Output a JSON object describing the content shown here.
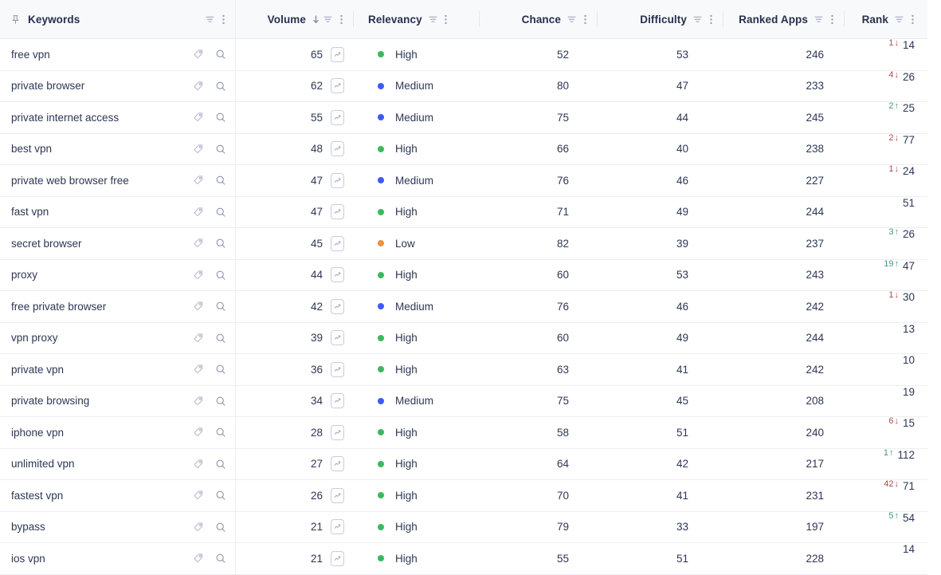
{
  "table": {
    "columns": [
      {
        "key": "keywords",
        "label": "Keywords",
        "align": "left",
        "pin_icon": "pushpin-icon",
        "sorted": false,
        "sort_dir": ""
      },
      {
        "key": "volume",
        "label": "Volume",
        "align": "right",
        "pin_icon": "",
        "sorted": true,
        "sort_dir": "desc"
      },
      {
        "key": "relevancy",
        "label": "Relevancy",
        "align": "left",
        "pin_icon": "",
        "sorted": false,
        "sort_dir": ""
      },
      {
        "key": "chance",
        "label": "Chance",
        "align": "right",
        "pin_icon": "",
        "sorted": false,
        "sort_dir": ""
      },
      {
        "key": "difficulty",
        "label": "Difficulty",
        "align": "right",
        "pin_icon": "",
        "sorted": false,
        "sort_dir": ""
      },
      {
        "key": "ranked_apps",
        "label": "Ranked Apps",
        "align": "right",
        "pin_icon": "",
        "sorted": false,
        "sort_dir": ""
      },
      {
        "key": "rank",
        "label": "Rank",
        "align": "right",
        "pin_icon": "",
        "sorted": false,
        "sort_dir": ""
      }
    ],
    "header_icons": {
      "filter": "filter-icon",
      "menu": "more-options-icon",
      "sort_desc": "sort-descending-arrow-icon"
    },
    "row_icons": {
      "tag": "tag-icon",
      "search": "magnifier-icon",
      "trend_chart": "trend-chart-icon"
    },
    "relevancy_colors": {
      "High": "#3cb95f",
      "Medium": "#3b5bfa",
      "Low": "#eb9240"
    },
    "delta_colors": {
      "up": "#3f9a80",
      "down": "#b5484a"
    },
    "rows": [
      {
        "keyword": "free vpn",
        "volume": "65",
        "relevancy": "High",
        "chance": "52",
        "difficulty": "53",
        "ranked_apps": "246",
        "rank_delta": "1",
        "rank_dir": "down",
        "rank": "14"
      },
      {
        "keyword": "private browser",
        "volume": "62",
        "relevancy": "Medium",
        "chance": "80",
        "difficulty": "47",
        "ranked_apps": "233",
        "rank_delta": "4",
        "rank_dir": "down",
        "rank": "26"
      },
      {
        "keyword": "private internet access",
        "volume": "55",
        "relevancy": "Medium",
        "chance": "75",
        "difficulty": "44",
        "ranked_apps": "245",
        "rank_delta": "2",
        "rank_dir": "up",
        "rank": "25"
      },
      {
        "keyword": "best vpn",
        "volume": "48",
        "relevancy": "High",
        "chance": "66",
        "difficulty": "40",
        "ranked_apps": "238",
        "rank_delta": "2",
        "rank_dir": "down",
        "rank": "77"
      },
      {
        "keyword": "private web browser free",
        "volume": "47",
        "relevancy": "Medium",
        "chance": "76",
        "difficulty": "46",
        "ranked_apps": "227",
        "rank_delta": "1",
        "rank_dir": "down",
        "rank": "24"
      },
      {
        "keyword": "fast vpn",
        "volume": "47",
        "relevancy": "High",
        "chance": "71",
        "difficulty": "49",
        "ranked_apps": "244",
        "rank_delta": "",
        "rank_dir": "",
        "rank": "51"
      },
      {
        "keyword": "secret browser",
        "volume": "45",
        "relevancy": "Low",
        "chance": "82",
        "difficulty": "39",
        "ranked_apps": "237",
        "rank_delta": "3",
        "rank_dir": "up",
        "rank": "26"
      },
      {
        "keyword": "proxy",
        "volume": "44",
        "relevancy": "High",
        "chance": "60",
        "difficulty": "53",
        "ranked_apps": "243",
        "rank_delta": "19",
        "rank_dir": "up",
        "rank": "47"
      },
      {
        "keyword": "free private browser",
        "volume": "42",
        "relevancy": "Medium",
        "chance": "76",
        "difficulty": "46",
        "ranked_apps": "242",
        "rank_delta": "1",
        "rank_dir": "down",
        "rank": "30"
      },
      {
        "keyword": "vpn proxy",
        "volume": "39",
        "relevancy": "High",
        "chance": "60",
        "difficulty": "49",
        "ranked_apps": "244",
        "rank_delta": "",
        "rank_dir": "",
        "rank": "13"
      },
      {
        "keyword": "private vpn",
        "volume": "36",
        "relevancy": "High",
        "chance": "63",
        "difficulty": "41",
        "ranked_apps": "242",
        "rank_delta": "",
        "rank_dir": "",
        "rank": "10"
      },
      {
        "keyword": "private browsing",
        "volume": "34",
        "relevancy": "Medium",
        "chance": "75",
        "difficulty": "45",
        "ranked_apps": "208",
        "rank_delta": "",
        "rank_dir": "",
        "rank": "19"
      },
      {
        "keyword": "iphone vpn",
        "volume": "28",
        "relevancy": "High",
        "chance": "58",
        "difficulty": "51",
        "ranked_apps": "240",
        "rank_delta": "6",
        "rank_dir": "down",
        "rank": "15"
      },
      {
        "keyword": "unlimited vpn",
        "volume": "27",
        "relevancy": "High",
        "chance": "64",
        "difficulty": "42",
        "ranked_apps": "217",
        "rank_delta": "1",
        "rank_dir": "up",
        "rank": "112"
      },
      {
        "keyword": "fastest vpn",
        "volume": "26",
        "relevancy": "High",
        "chance": "70",
        "difficulty": "41",
        "ranked_apps": "231",
        "rank_delta": "42",
        "rank_dir": "down",
        "rank": "71"
      },
      {
        "keyword": "bypass",
        "volume": "21",
        "relevancy": "High",
        "chance": "79",
        "difficulty": "33",
        "ranked_apps": "197",
        "rank_delta": "5",
        "rank_dir": "up",
        "rank": "54"
      },
      {
        "keyword": "ios vpn",
        "volume": "21",
        "relevancy": "High",
        "chance": "55",
        "difficulty": "51",
        "ranked_apps": "228",
        "rank_delta": "",
        "rank_dir": "",
        "rank": "14"
      }
    ]
  }
}
